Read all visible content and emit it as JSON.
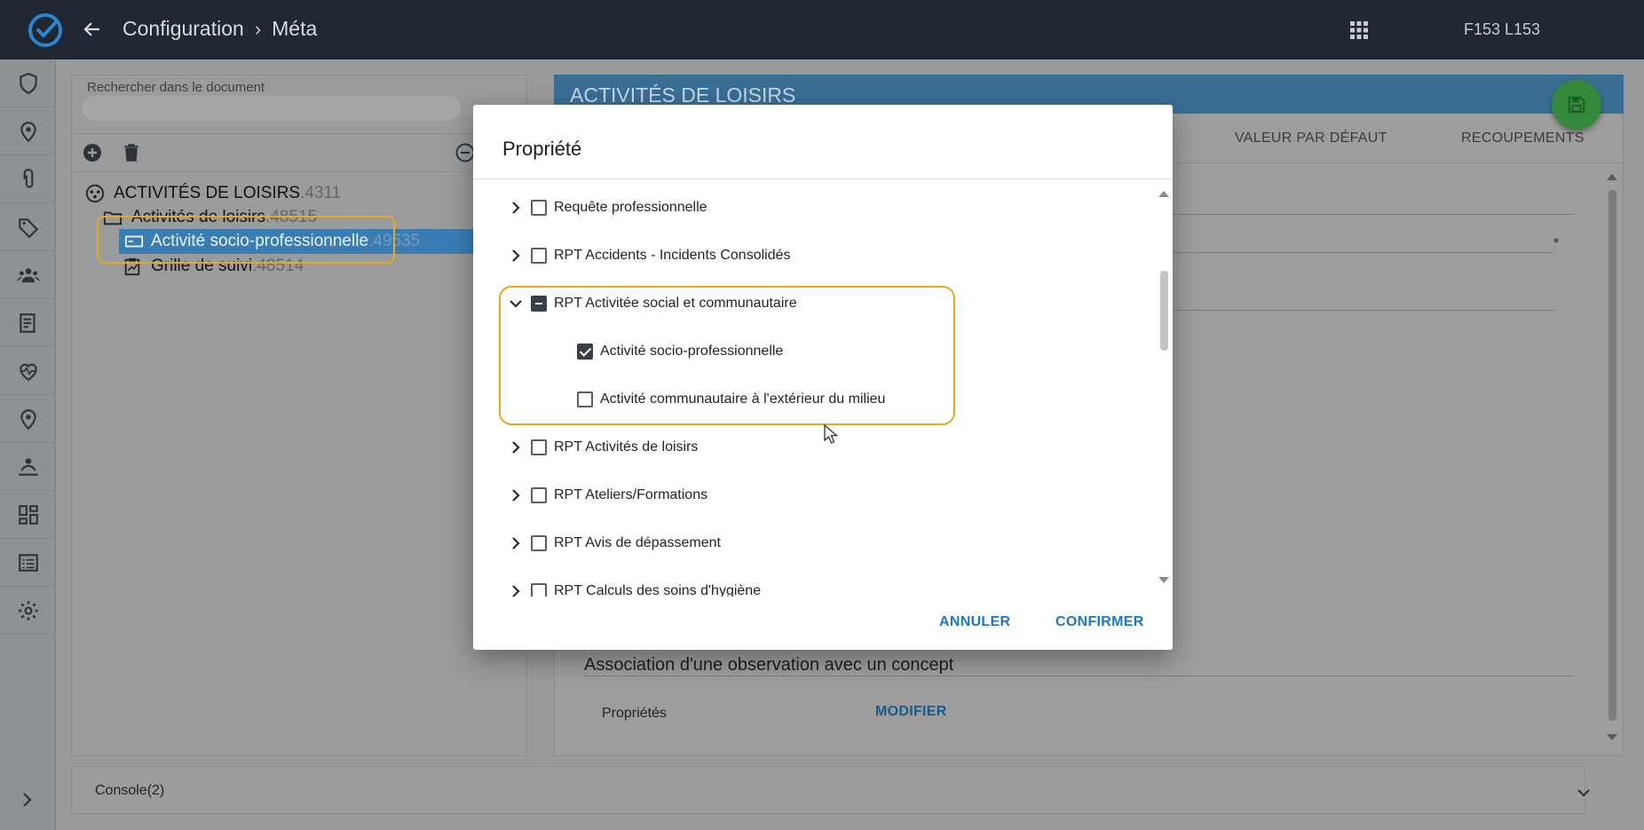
{
  "topbar": {
    "breadcrumb": [
      "Configuration",
      "Méta"
    ],
    "user": "F153 L153"
  },
  "left_panel": {
    "search_label": "Rechercher dans le document",
    "tree": [
      {
        "label": "ACTIVITÉS DE LOISIRS",
        "id": ".4311"
      },
      {
        "label": "Activités de loisirs",
        "id": ".48515"
      },
      {
        "label": "Activité socio-professionnelle",
        "id": ".49535"
      },
      {
        "label": "Grille de suivi",
        "id": ".48514"
      }
    ]
  },
  "right_panel": {
    "header_title": "ACTIVITÉS DE LOISIRS",
    "tabs": [
      "VALEUR PAR DÉFAUT",
      "RECOUPEMENTS"
    ],
    "required_marker": "*",
    "association_title": "Association d'une observation avec un concept",
    "properties_label": "Propriétés",
    "modify_label": "MODIFIER"
  },
  "console": {
    "label": "Console(2)"
  },
  "dialog": {
    "title": "Propriété",
    "items": [
      {
        "label": "Requête professionnelle",
        "state": "unchecked",
        "level": 0,
        "expanded": false
      },
      {
        "label": "RPT Accidents - Incidents Consolidés",
        "state": "unchecked",
        "level": 0,
        "expanded": false
      },
      {
        "label": "RPT Activitée social et communautaire",
        "state": "indeterminate",
        "level": 0,
        "expanded": true
      },
      {
        "label": "Activité socio-professionnelle",
        "state": "checked",
        "level": 1
      },
      {
        "label": "Activité communautaire à l'extérieur du milieu",
        "state": "unchecked",
        "level": 1
      },
      {
        "label": "RPT Activités de loisirs",
        "state": "unchecked",
        "level": 0,
        "expanded": false
      },
      {
        "label": "RPT Ateliers/Formations",
        "state": "unchecked",
        "level": 0,
        "expanded": false
      },
      {
        "label": "RPT Avis de dépassement",
        "state": "unchecked",
        "level": 0,
        "expanded": false
      },
      {
        "label": "RPT Calculs des soins d'hygiène",
        "state": "unchecked",
        "level": 0,
        "expanded": false
      }
    ],
    "cancel_label": "ANNULER",
    "confirm_label": "CONFIRMER"
  },
  "colors": {
    "topbar": "#1e2732",
    "accent": "#1c77c6",
    "highlight": "#e9a91c",
    "save_fab": "#348a3a"
  }
}
